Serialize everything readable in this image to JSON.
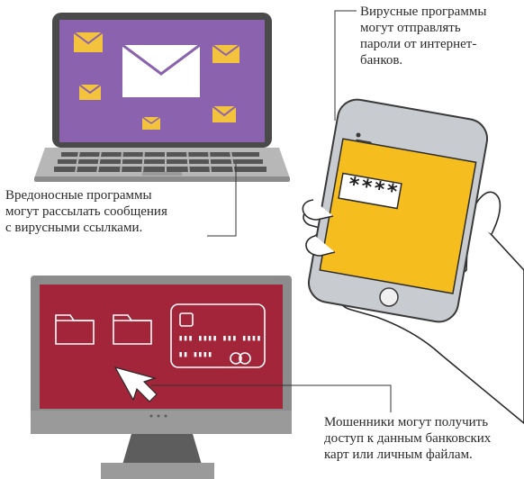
{
  "captions": {
    "phone": [
      "Вирусные программы",
      "могут отправлять",
      "пароли от интернет-",
      "банков."
    ],
    "laptop": [
      "Вредоносные программы",
      "могут рассылать сообщения",
      "с вирусными ссылками."
    ],
    "monitor": [
      "Мошенники могут получить",
      "доступ к данным банковских",
      "карт или личным файлам."
    ]
  },
  "phone_screen": {
    "password": "****"
  },
  "card": {
    "number_line": "▮▮▮ ▮▮▮▮ ▮▮▮ ▮▮▮▮",
    "name_line": "▮▮ ▮▮▮▮"
  },
  "colors": {
    "laptop_screen": "#8a62ad",
    "envelope": "#f3c33e",
    "phone_screen": "#f5bd1d",
    "monitor_screen": "#a3253a",
    "device_gray": "#8c8c8c",
    "device_dark": "#3e3e3e"
  },
  "icons": [
    "envelope-icon",
    "folder-icon",
    "bank-card-icon",
    "cursor-icon",
    "hand-icon",
    "smartphone-icon",
    "laptop-icon",
    "monitor-icon"
  ]
}
